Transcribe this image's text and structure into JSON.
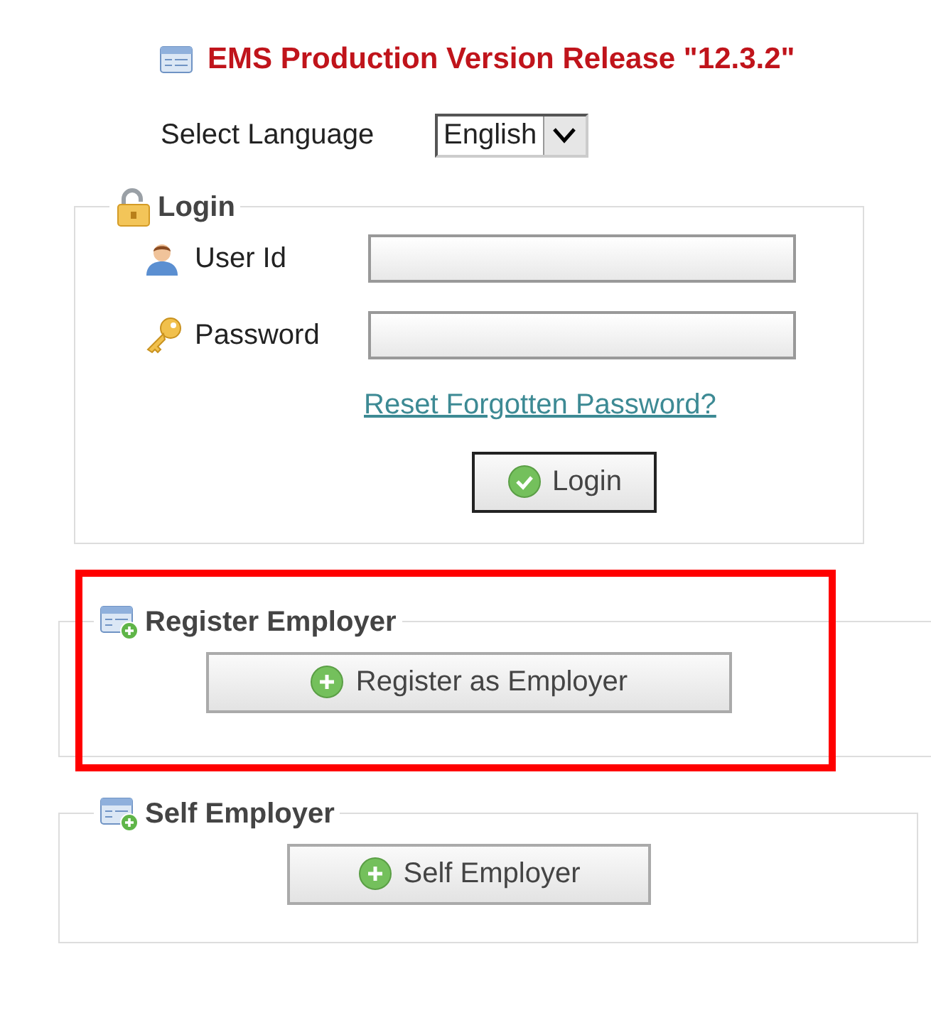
{
  "header": {
    "title": "EMS Production Version Release \"12.3.2\""
  },
  "language": {
    "label": "Select Language",
    "value": "English"
  },
  "login": {
    "legend": "Login",
    "fields": [
      {
        "kind": "user",
        "label": "User Id"
      },
      {
        "kind": "password",
        "label": "Password"
      }
    ],
    "reset_link": "Reset Forgotten Password?",
    "button": "Login"
  },
  "register_employer": {
    "legend": "Register Employer",
    "button": "Register as Employer",
    "highlighted": true
  },
  "self_employer": {
    "legend": "Self Employer",
    "button": "Self Employer",
    "highlighted": false
  }
}
